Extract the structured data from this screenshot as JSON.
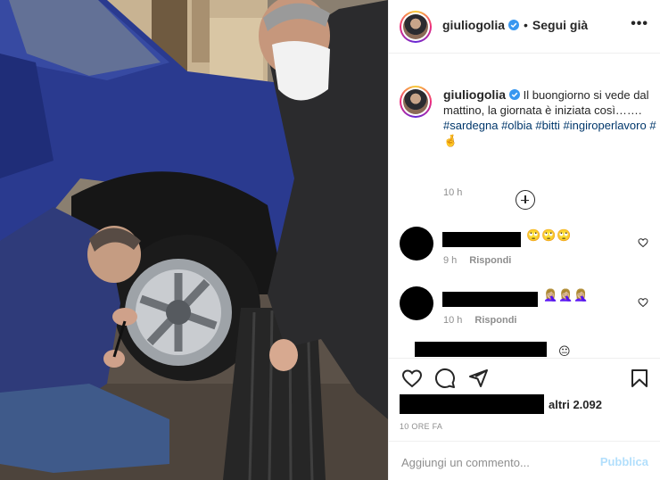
{
  "post": {
    "username": "giuliogolia",
    "verified": true,
    "follow_status": "Segui già",
    "separator": "•",
    "more_label": "•••"
  },
  "caption": {
    "username": "giuliogolia",
    "text_parts": [
      {
        "text": " Il buongiorno si vede dal mattino, la giornata è iniziata così……. ",
        "type": "text"
      },
      {
        "text": "#sardegna",
        "type": "tag"
      },
      {
        "text": " ",
        "type": "text"
      },
      {
        "text": "#olbia",
        "type": "tag"
      },
      {
        "text": " ",
        "type": "text"
      },
      {
        "text": "#bitti",
        "type": "tag"
      },
      {
        "text": " ",
        "type": "text"
      },
      {
        "text": "#ingiroperlavoro",
        "type": "tag"
      },
      {
        "text": " ",
        "type": "text"
      },
      {
        "text": "#",
        "type": "tag"
      },
      {
        "text": "🤞",
        "type": "text"
      }
    ],
    "time": "10 h"
  },
  "comments": [
    {
      "emoji": "🙄🙄🙄",
      "time": "9 h",
      "reply_label": "Rispondi"
    },
    {
      "emoji": "🤦🏼‍♀️🤦🏼‍♀️🤦🏼‍♀️",
      "time": "10 h",
      "reply_label": "Rispondi"
    },
    {
      "emoji": "😐",
      "time": "",
      "reply_label": ""
    }
  ],
  "likes": {
    "others_text": "altri 2.092"
  },
  "post_time": "10 ORE FA",
  "add_comment": {
    "placeholder": "Aggiungi un commento...",
    "publish_label": "Pubblica"
  },
  "colors": {
    "hashtag": "#00376b",
    "verified": "#3897f0",
    "publish_disabled": "#b2dffc",
    "car_body": "#2a3a8f"
  },
  "icons": [
    "more-icon",
    "verified-icon",
    "load-more-icon",
    "heart-icon",
    "comment-icon",
    "share-icon",
    "bookmark-icon"
  ]
}
